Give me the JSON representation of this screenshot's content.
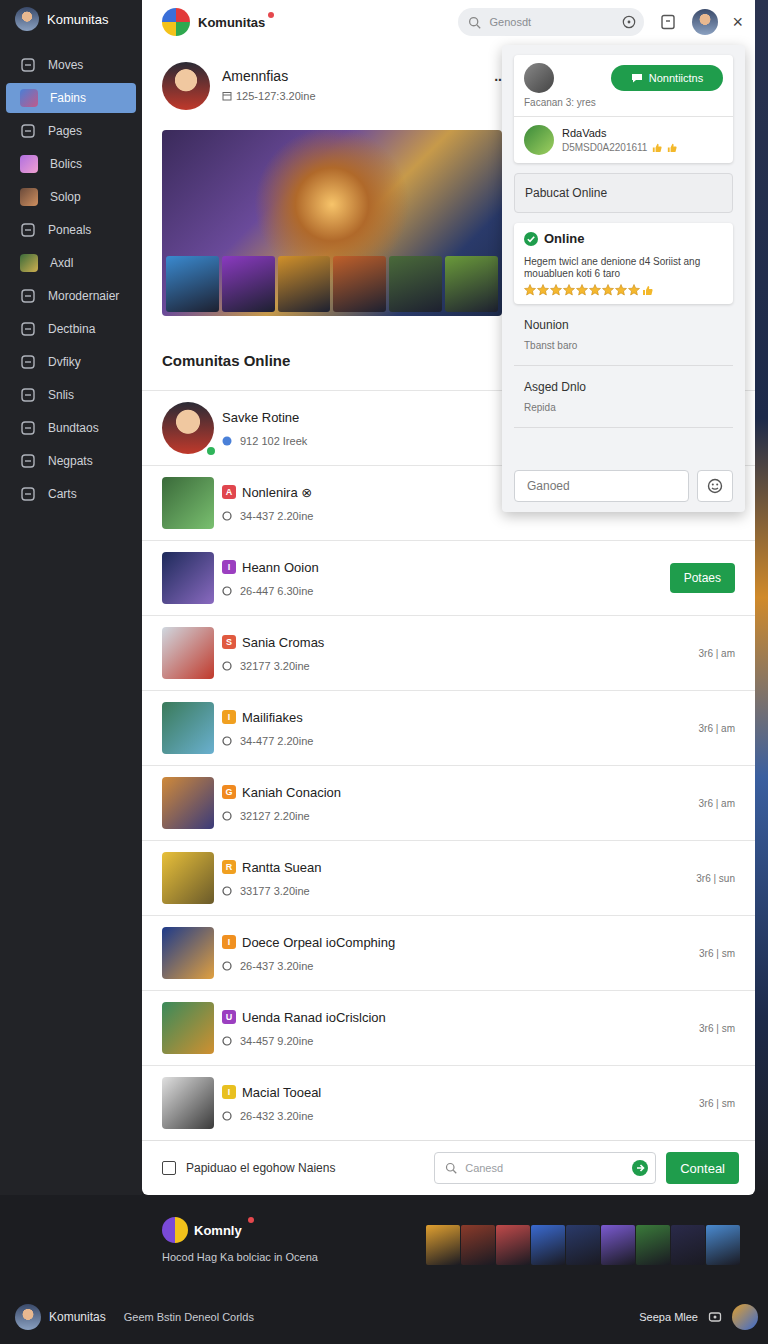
{
  "sidebar": {
    "title": "Komunitas",
    "items": [
      {
        "label": "Moves",
        "kind": "icon",
        "selected": false
      },
      {
        "label": "Fabins",
        "kind": "avatar",
        "selected": true
      },
      {
        "label": "Pages",
        "kind": "icon",
        "selected": false
      },
      {
        "label": "Bolics",
        "kind": "avatar",
        "selected": false
      },
      {
        "label": "Solop",
        "kind": "avatar",
        "selected": false
      },
      {
        "label": "Poneals",
        "kind": "icon",
        "selected": false
      },
      {
        "label": "Axdl",
        "kind": "avatar",
        "selected": false
      },
      {
        "label": "Morodernaier",
        "kind": "icon",
        "selected": false
      },
      {
        "label": "Dectbina",
        "kind": "icon",
        "selected": false
      },
      {
        "label": "Dvfiky",
        "kind": "icon",
        "selected": false
      },
      {
        "label": "Snlis",
        "kind": "icon",
        "selected": false
      },
      {
        "label": "Bundtaos",
        "kind": "icon",
        "selected": false
      },
      {
        "label": "Negpats",
        "kind": "icon",
        "selected": false
      },
      {
        "label": "Carts",
        "kind": "icon",
        "selected": false
      }
    ]
  },
  "header": {
    "title": "Komunitas",
    "search": {
      "placeholder": "Genosdt"
    },
    "close": "×"
  },
  "post": {
    "author": "Amennfias",
    "meta": "125-127:3.20ine",
    "more": ".."
  },
  "popup": {
    "user_button": "Nonntiictns",
    "user_meta": "Facanan 3: yres",
    "contact": {
      "name": "RdaVads",
      "meta": "D5MSD0A2201611"
    },
    "status_box": "Pabucat Online",
    "online": {
      "title": "Online",
      "text": "Hegem twicl ane denione d4 Soriist ang mouabluen koti 6 taro",
      "stars": 9,
      "max_stars": 9
    },
    "sections": [
      {
        "title": "Nounion",
        "subtitle": "Tbanst baro"
      },
      {
        "title": "Asged Dnlo",
        "subtitle": "Repida"
      }
    ],
    "input": {
      "placeholder": "Ganoed"
    }
  },
  "online": {
    "heading": "Comunitas Online",
    "rows": [
      {
        "kind": "member",
        "name": "Savke Rotine",
        "meta": "912 102 Ireek",
        "color": "#4a80d8",
        "online": true
      },
      {
        "kind": "community",
        "badge": "A",
        "color": "#e0464e",
        "name": "Nonlenira ⊗",
        "meta": "34-437 2.20ine",
        "online": false
      },
      {
        "kind": "community",
        "badge": "I",
        "color": "#9b3fc0",
        "name": "Heann Ooion",
        "meta": "26-447 6.30ine",
        "online": false,
        "button": "Potaes"
      },
      {
        "kind": "community",
        "badge": "S",
        "color": "#e05a40",
        "name": "Sania Cromas",
        "meta": "32177 3.20ine",
        "online": false,
        "time": "3r6 | am"
      },
      {
        "kind": "community",
        "badge": "I",
        "color": "#f0a020",
        "name": "Mailifiakes",
        "meta": "34-477 2.20ine",
        "online": false,
        "time": "3r6 | am"
      },
      {
        "kind": "community",
        "badge": "G",
        "color": "#f08a20",
        "name": "Kaniah Conacion",
        "meta": "32127 2.20ine",
        "online": false,
        "time": "3r6 | am"
      },
      {
        "kind": "community",
        "badge": "R",
        "color": "#f0a020",
        "name": "Rantta Suean",
        "meta": "33177 3.20ine",
        "online": false,
        "time": "3r6 | sun"
      },
      {
        "kind": "community",
        "badge": "I",
        "color": "#f09020",
        "name": "Doece Orpeal ioComphing",
        "meta": "26-437 3.20ine",
        "online": false,
        "time": "3r6 | sm"
      },
      {
        "kind": "community",
        "badge": "U",
        "color": "#9b3fc0",
        "name": "Uenda Ranad ioCrislcion",
        "meta": "34-457 9.20ine",
        "online": false,
        "time": "3r6 | sm"
      },
      {
        "kind": "community",
        "badge": "I",
        "color": "#e8c020",
        "name": "Macial Tooeal",
        "meta": "26-432 3.20ine",
        "online": false,
        "time": "3r6 | sm"
      }
    ]
  },
  "composer": {
    "checkbox_label": "Papiduao el egohow Naiens",
    "checked": false,
    "search": {
      "placeholder": "Canesd"
    },
    "button": "Conteal"
  },
  "promo": {
    "title": "Komnly",
    "subtitle": "Hocod Hag Ka bolciac in Ocena"
  },
  "footer": {
    "title": "Komunitas",
    "subtitle": "Geem Bstin Deneol Corlds",
    "right": "Seepa Mlee"
  }
}
